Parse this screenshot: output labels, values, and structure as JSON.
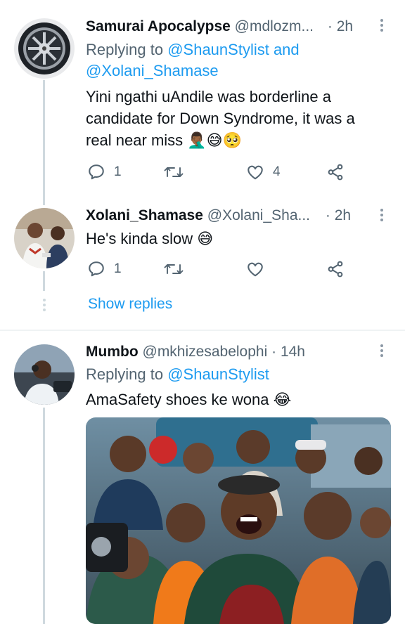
{
  "tweets": [
    {
      "display_name": "Samurai Apocalypse",
      "handle": "@mdlozm...",
      "dot": "·",
      "time": "2h",
      "replying_prefix": "Replying to",
      "replying_mentions": "@ShaunStylist and @Xolani_Shamase",
      "text": "Yini ngathi uAndile was borderline a candidate for Down Syndrome, it was a real near miss 🤦🏾‍♂️😅🥺",
      "reply_count": "1",
      "retweet_count": "",
      "like_count": "4"
    },
    {
      "display_name": "Xolani_Shamase",
      "handle": "@Xolani_Sha...",
      "dot": "·",
      "time": "2h",
      "text": "He's kinda slow 😅",
      "reply_count": "1",
      "retweet_count": "",
      "like_count": ""
    },
    {
      "display_name": "Mumbo",
      "handle": "@mkhizesabelophi",
      "dot": "·",
      "time": "14h",
      "replying_prefix": "Replying to",
      "replying_mentions": "@ShaunStylist",
      "text": "AmaSafety shoes ke wona 😂"
    }
  ],
  "show_replies_label": "Show replies",
  "colors": {
    "accent": "#1d9bf0",
    "secondary_text": "#536471",
    "thread_line": "#cfd9de"
  },
  "icons": [
    "more-vertical-icon",
    "reply-icon",
    "retweet-icon",
    "like-icon",
    "share-icon"
  ]
}
